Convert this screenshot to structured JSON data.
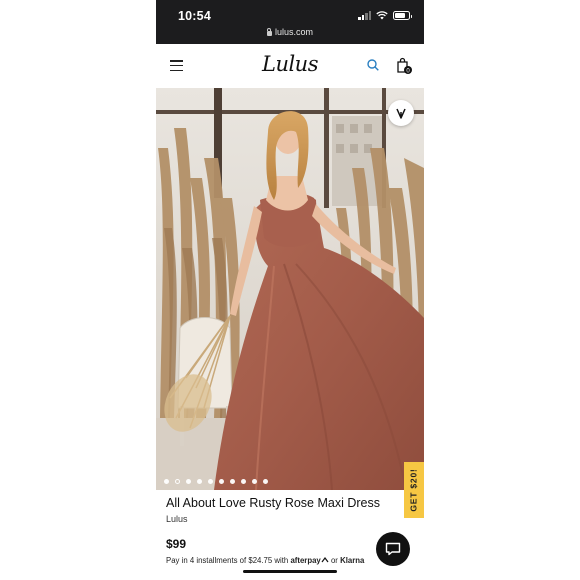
{
  "status_bar": {
    "time": "10:54"
  },
  "browser": {
    "url": "lulus.com"
  },
  "header": {
    "logo": "Lulus",
    "menu_icon": "hamburger-menu-icon",
    "search_icon": "search-icon",
    "bag_icon": "shopping-bag-icon",
    "bag_count": "0",
    "accent_color": "#2a7fc1"
  },
  "gallery": {
    "image_count": 10,
    "active_index": 1,
    "wishlist_icon": "heart-icon"
  },
  "promo": {
    "label": "GET $20!",
    "color": "#f6c743"
  },
  "product": {
    "title": "All About Love Rusty Rose Maxi Dress",
    "brand": "Lulus",
    "price": "$99",
    "installments_prefix": "Pay in 4 installments of",
    "installment_amount": "$24.75",
    "installments_with": "with",
    "afterpay": "afterpay",
    "installments_or": "or",
    "klarna": "Klarna"
  },
  "chat": {
    "icon": "chat-bubble-icon"
  }
}
